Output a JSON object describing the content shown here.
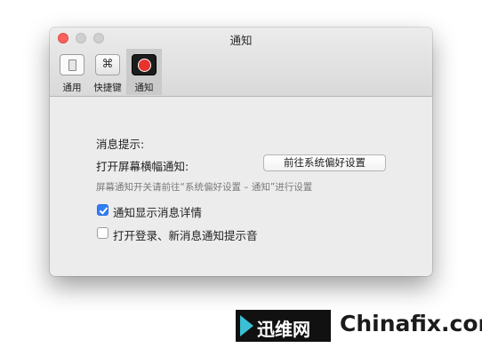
{
  "window": {
    "title": "通知",
    "tabs": [
      {
        "label": "通用",
        "icon": "general-switch-icon"
      },
      {
        "label": "快捷键",
        "icon": "command-key-icon",
        "glyph": "⌘"
      },
      {
        "label": "通知",
        "icon": "notification-record-icon",
        "active": true
      }
    ]
  },
  "content": {
    "section_label": "消息提示:",
    "banner_label": "打开屏幕横幅通知:",
    "open_prefs_button": "前往系统偏好设置",
    "hint": "屏幕通知开关请前往“系统偏好设置 – 通知”进行设置",
    "show_detail": {
      "label": "通知显示消息详情",
      "checked": true
    },
    "sound": {
      "label": "打开登录、新消息通知提示音",
      "checked": false
    }
  },
  "watermark": {
    "brand": "迅维网",
    "site": "Chinafix.com"
  },
  "colors": {
    "accent_blue": "#2f7ef6",
    "close_red": "#fc605b",
    "record_red": "#e8322c"
  }
}
